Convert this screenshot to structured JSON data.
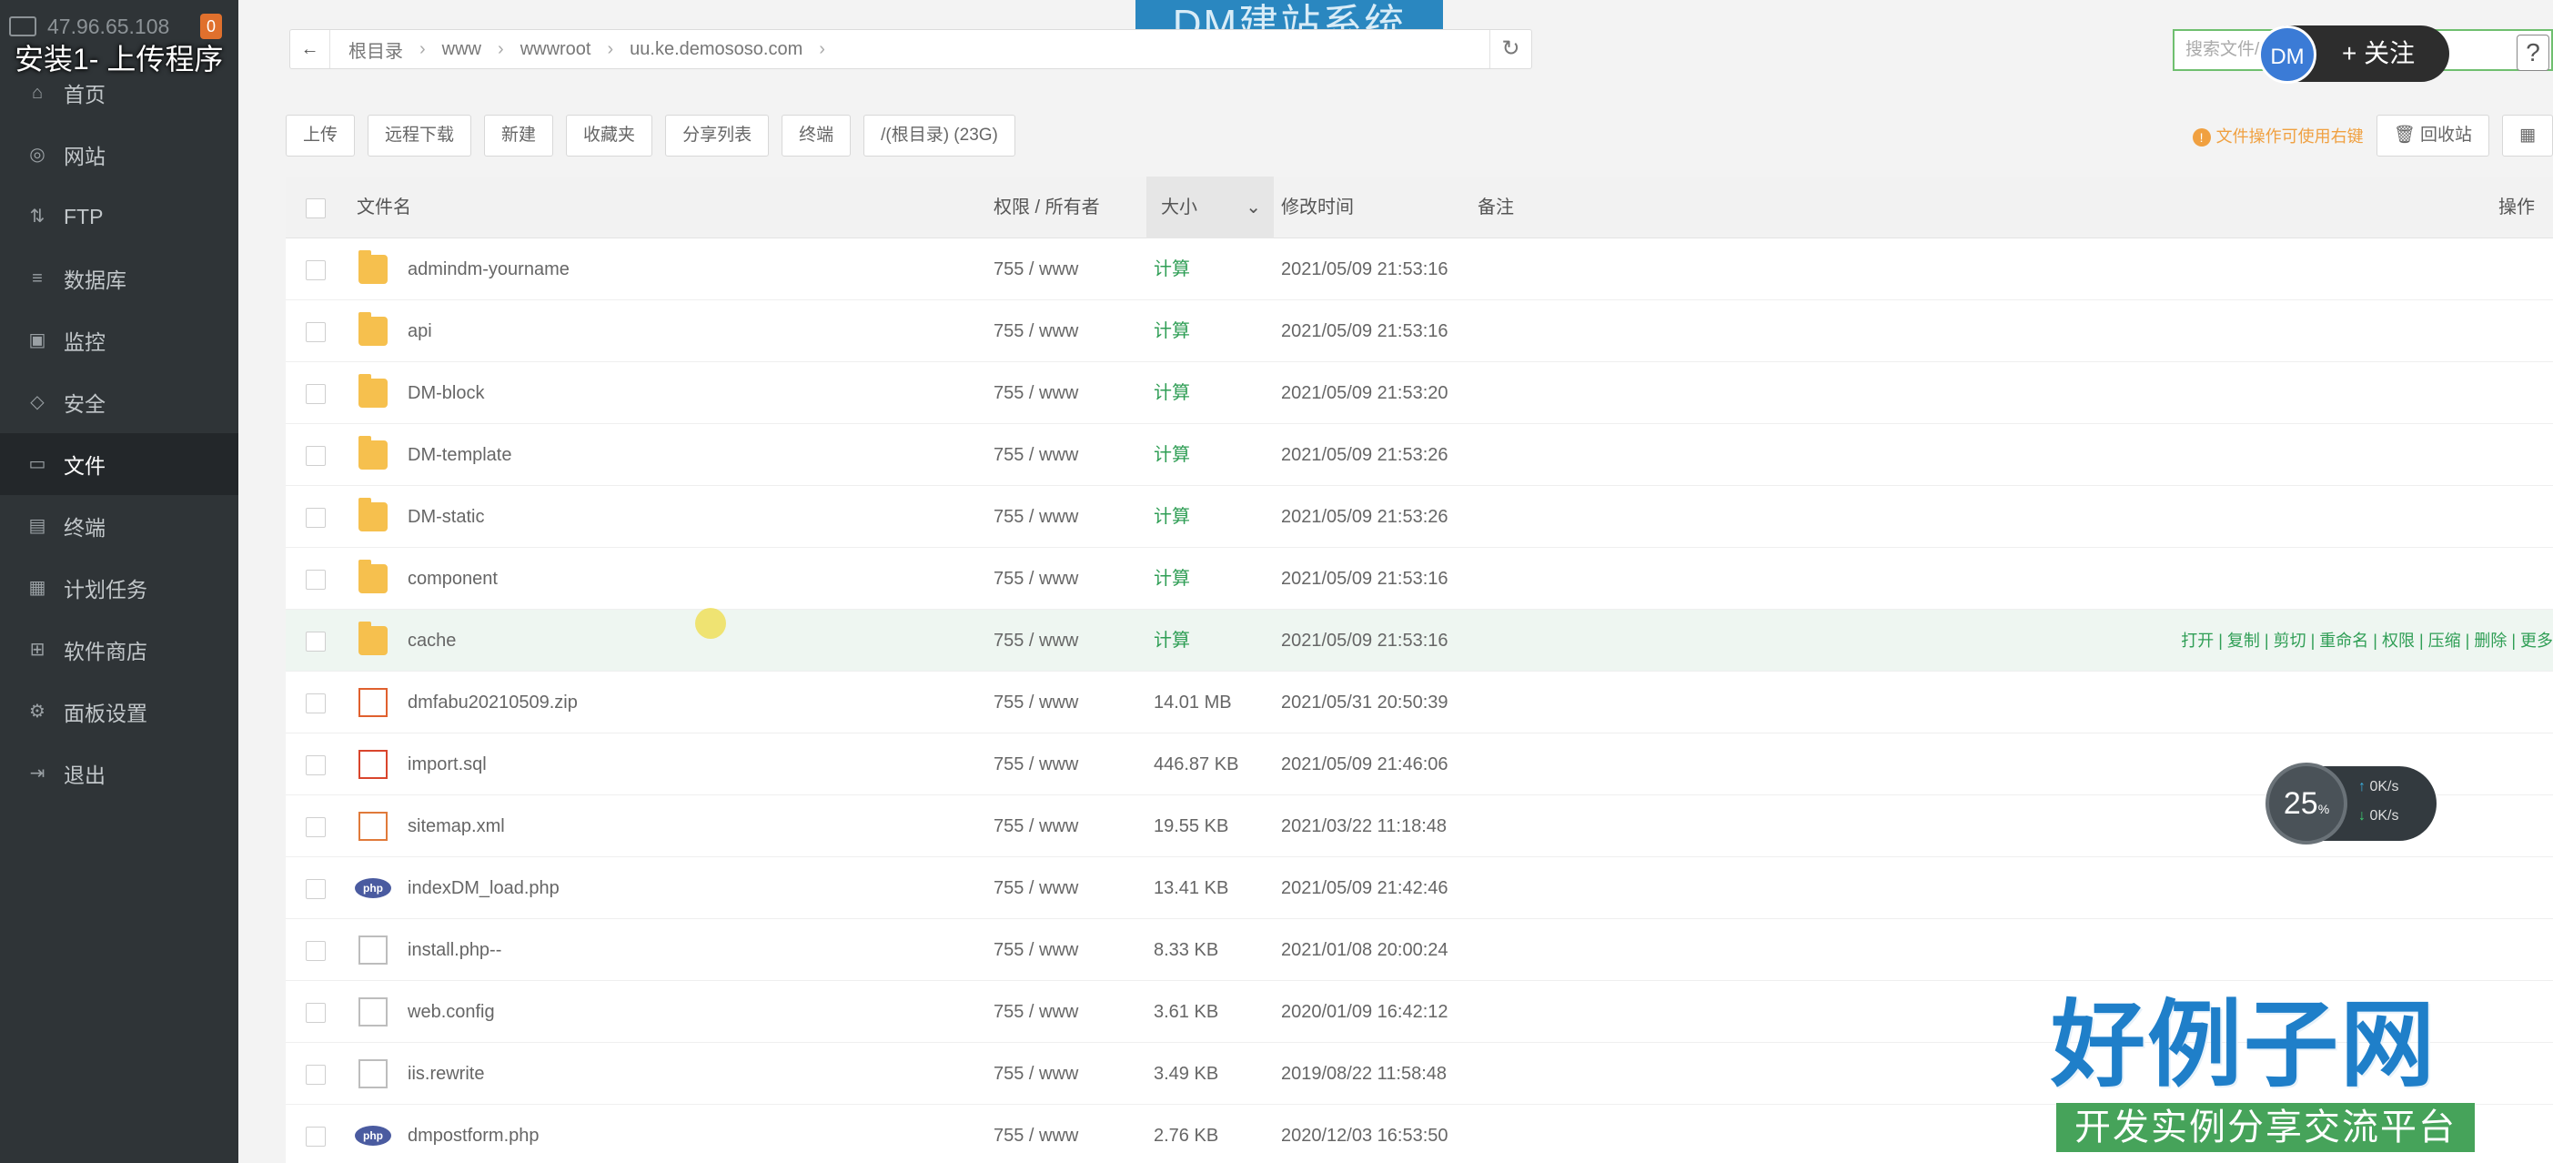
{
  "overlay_title": "安装1- 上传程序",
  "sidebar": {
    "ip": "47.96.65.108",
    "badge": "0",
    "items": [
      {
        "label": "首页",
        "icon": "home-icon",
        "active": false
      },
      {
        "label": "网站",
        "icon": "globe-icon",
        "active": false
      },
      {
        "label": "FTP",
        "icon": "ftp-icon",
        "active": false
      },
      {
        "label": "数据库",
        "icon": "database-icon",
        "active": false
      },
      {
        "label": "监控",
        "icon": "monitor-icon",
        "active": false
      },
      {
        "label": "安全",
        "icon": "shield-icon",
        "active": false
      },
      {
        "label": "文件",
        "icon": "folder-icon",
        "active": true
      },
      {
        "label": "终端",
        "icon": "terminal-icon",
        "active": false
      },
      {
        "label": "计划任务",
        "icon": "calendar-icon",
        "active": false
      },
      {
        "label": "软件商店",
        "icon": "apps-icon",
        "active": false
      },
      {
        "label": "面板设置",
        "icon": "settings-icon",
        "active": false
      },
      {
        "label": "退出",
        "icon": "logout-icon",
        "active": false
      }
    ]
  },
  "brand": "DM建站系统",
  "path": {
    "crumbs": [
      "根目录",
      "www",
      "wwwroot",
      "uu.ke.demososo.com"
    ]
  },
  "search": {
    "placeholder": "搜索文件/目录…含子目录"
  },
  "follow": {
    "avatar": "DM",
    "label": "+ 关注"
  },
  "help": "?",
  "toolbar": {
    "buttons": [
      "上传",
      "远程下载",
      "新建",
      "收藏夹",
      "分享列表",
      "终端",
      "/(根目录) (23G)"
    ],
    "tip": "文件操作可使用右键",
    "recycle": "回收站"
  },
  "table": {
    "headers": {
      "name": "文件名",
      "perm": "权限 / 所有者",
      "size": "大小",
      "mtime": "修改时间",
      "note": "备注",
      "ops": "操作"
    },
    "rows": [
      {
        "name": "admindm-yourname",
        "type": "folder",
        "perm": "755 / www",
        "size": "计算",
        "mtime": "2021/05/09 21:53:16"
      },
      {
        "name": "api",
        "type": "folder",
        "perm": "755 / www",
        "size": "计算",
        "mtime": "2021/05/09 21:53:16"
      },
      {
        "name": "DM-block",
        "type": "folder",
        "perm": "755 / www",
        "size": "计算",
        "mtime": "2021/05/09 21:53:20"
      },
      {
        "name": "DM-template",
        "type": "folder",
        "perm": "755 / www",
        "size": "计算",
        "mtime": "2021/05/09 21:53:26"
      },
      {
        "name": "DM-static",
        "type": "folder",
        "perm": "755 / www",
        "size": "计算",
        "mtime": "2021/05/09 21:53:26"
      },
      {
        "name": "component",
        "type": "folder",
        "perm": "755 / www",
        "size": "计算",
        "mtime": "2021/05/09 21:53:16"
      },
      {
        "name": "cache",
        "type": "folder",
        "perm": "755 / www",
        "size": "计算",
        "mtime": "2021/05/09 21:53:16",
        "hover": true
      },
      {
        "name": "dmfabu20210509.zip",
        "type": "zip",
        "perm": "755 / www",
        "size": "14.01 MB",
        "mtime": "2021/05/31 20:50:39"
      },
      {
        "name": "import.sql",
        "type": "sql",
        "perm": "755 / www",
        "size": "446.87 KB",
        "mtime": "2021/05/09 21:46:06"
      },
      {
        "name": "sitemap.xml",
        "type": "xml",
        "perm": "755 / www",
        "size": "19.55 KB",
        "mtime": "2021/03/22 11:18:48"
      },
      {
        "name": "indexDM_load.php",
        "type": "php",
        "perm": "755 / www",
        "size": "13.41 KB",
        "mtime": "2021/05/09 21:42:46"
      },
      {
        "name": "install.php--",
        "type": "doc",
        "perm": "755 / www",
        "size": "8.33 KB",
        "mtime": "2021/01/08 20:00:24"
      },
      {
        "name": "web.config",
        "type": "doc",
        "perm": "755 / www",
        "size": "3.61 KB",
        "mtime": "2020/01/09 16:42:12"
      },
      {
        "name": "iis.rewrite",
        "type": "doc",
        "perm": "755 / www",
        "size": "3.49 KB",
        "mtime": "2019/08/22 11:58:48"
      },
      {
        "name": "dmpostform.php",
        "type": "php",
        "perm": "755 / www",
        "size": "2.76 KB",
        "mtime": "2020/12/03 16:53:50"
      }
    ],
    "row_ops": "打开 | 复制 | 剪切 | 重命名 | 权限 | 压缩 | 删除 | 更多"
  },
  "speed": {
    "percent": "25",
    "up": "0K/s",
    "down": "0K/s"
  },
  "watermark": {
    "title": "好例子网",
    "subtitle": "开发实例分享交流平台"
  },
  "colors": {
    "sidebar": "#2f3437",
    "accent": "#2f9e55",
    "folder": "#f6c04e",
    "brand": "#2a87c0"
  }
}
